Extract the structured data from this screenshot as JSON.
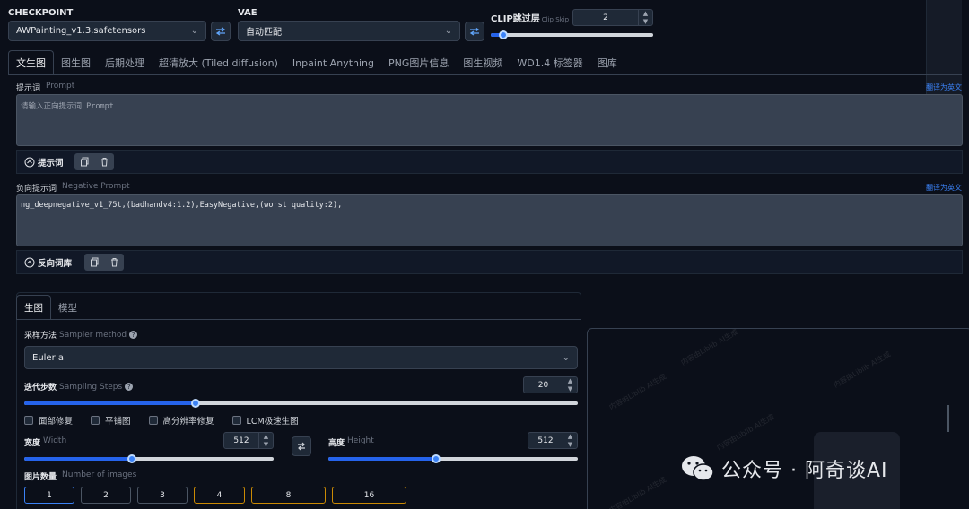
{
  "top": {
    "checkpoint_label": "CHECKPOINT",
    "checkpoint_value": "AWPainting_v1.3.safetensors",
    "vae_label": "VAE",
    "vae_value": "自动匹配",
    "clip_label": "CLIP跳过层",
    "clip_sub": "Clip Skip",
    "clip_value": "2",
    "clip_level": 0.08
  },
  "tabs": [
    {
      "label": "文生图",
      "active": true
    },
    {
      "label": "图生图"
    },
    {
      "label": "后期处理"
    },
    {
      "label": "超清放大 (Tiled diffusion)"
    },
    {
      "label": "Inpaint Anything"
    },
    {
      "label": "PNG图片信息"
    },
    {
      "label": "图生视频"
    },
    {
      "label": "WD1.4 标签器"
    },
    {
      "label": "图库"
    }
  ],
  "prompt": {
    "label": "提示词",
    "label_en": "Prompt",
    "translate": "翻译为英文",
    "placeholder": "请输入正向提示词 Prompt",
    "lib_label": "提示词"
  },
  "negative": {
    "label": "负向提示词",
    "label_en": "Negative Prompt",
    "translate": "翻译为英文",
    "value": "ng_deepnegative_v1_75t,(badhandv4:1.2),EasyNegative,(worst quality:2),",
    "lib_label": "反向词库"
  },
  "gen": {
    "tab_generate": "生图",
    "tab_model": "模型",
    "sampler_label": "采样方法",
    "sampler_label_en": "Sampler method",
    "sampler_value": "Euler a",
    "steps_label": "迭代步数",
    "steps_label_en": "Sampling Steps",
    "steps_value": "20",
    "steps_level": 0.31,
    "checkboxes": [
      "面部修复",
      "平铺图",
      "高分辨率修复",
      "LCM极速生图"
    ],
    "width_label": "宽度",
    "width_label_en": "Width",
    "width_value": "512",
    "width_level": 0.43,
    "height_label": "高度",
    "height_label_en": "Height",
    "height_value": "512",
    "height_level": 0.43,
    "count_label": "图片数量",
    "count_label_en": "Number of images",
    "counts": [
      "1",
      "2",
      "3",
      "4",
      "8",
      "16"
    ]
  },
  "watermark": {
    "brand": "公众号 · 阿奇谈AI",
    "tile": "内容由Liblib AI生成"
  },
  "colors": {
    "accent": "#2563eb",
    "gold": "#ca8a04",
    "bg": "#0b0f19"
  }
}
